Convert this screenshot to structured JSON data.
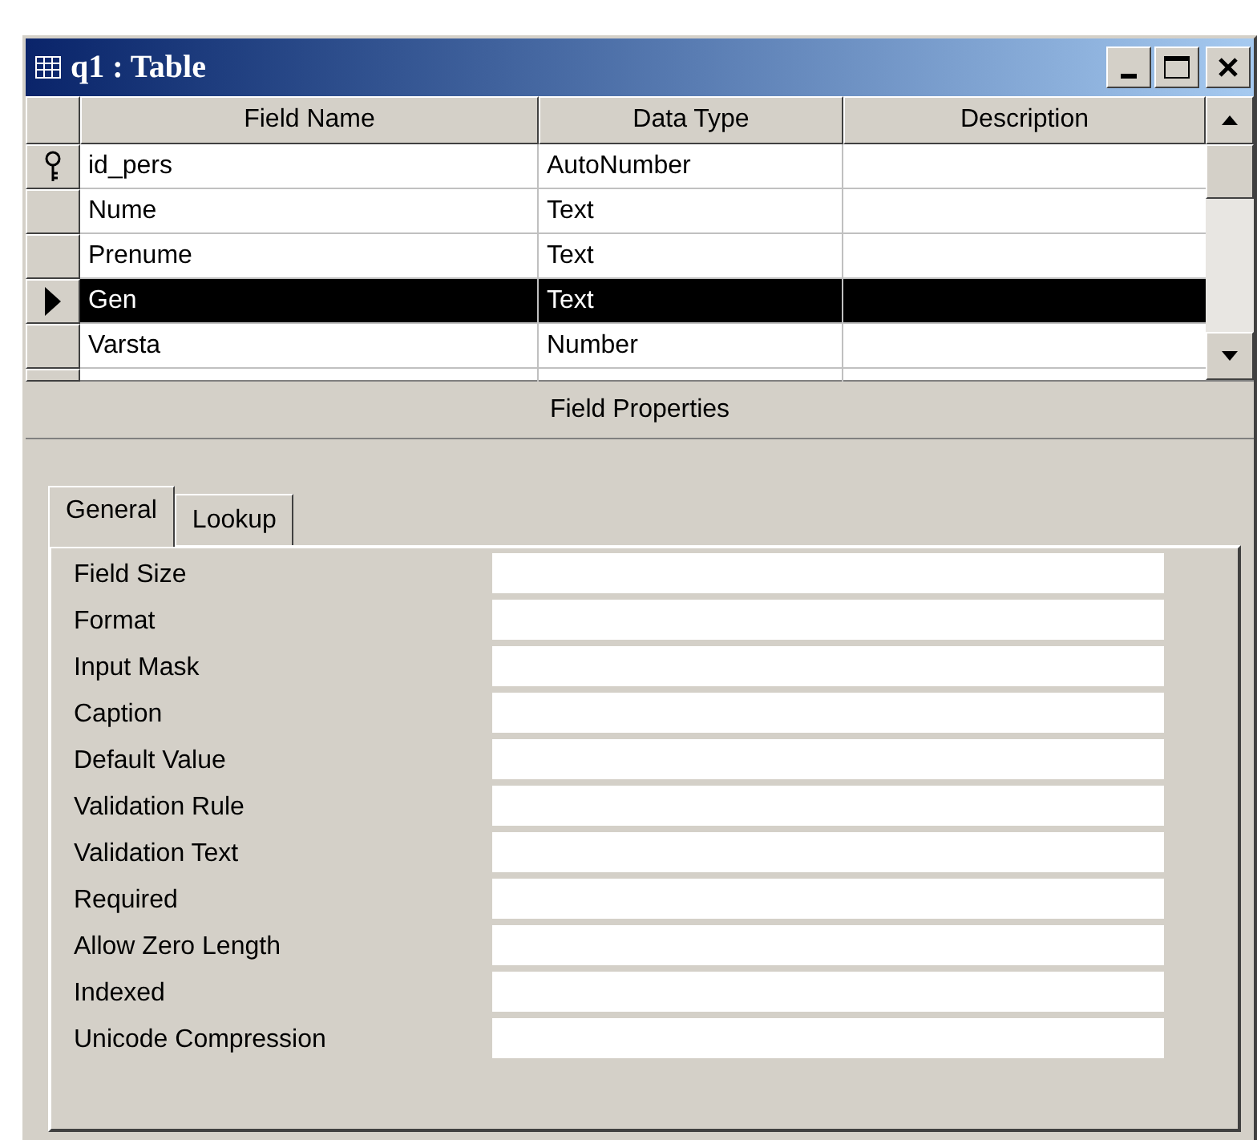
{
  "window": {
    "title": "q1 : Table"
  },
  "table": {
    "columns": [
      "Field Name",
      "Data Type",
      "Description"
    ],
    "rows": [
      {
        "field_name": "id_pers",
        "data_type": "AutoNumber",
        "primary_key": true,
        "selected": false
      },
      {
        "field_name": "Nume",
        "data_type": "Text",
        "primary_key": false,
        "selected": false
      },
      {
        "field_name": "Prenume",
        "data_type": "Text",
        "primary_key": false,
        "selected": false
      },
      {
        "field_name": "Gen",
        "data_type": "Text",
        "primary_key": false,
        "selected": true
      },
      {
        "field_name": "Varsta",
        "data_type": "Number",
        "primary_key": false,
        "selected": false
      }
    ]
  },
  "field_properties": {
    "title": "Field Properties",
    "tabs": [
      {
        "label": "General",
        "selected": true
      },
      {
        "label": "Lookup",
        "selected": false
      }
    ],
    "properties": [
      "Field Size",
      "Format",
      "Input Mask",
      "Caption",
      "Default Value",
      "Validation Rule",
      "Validation Text",
      "Required",
      "Allow Zero Length",
      "Indexed",
      "Unicode Compression"
    ]
  }
}
